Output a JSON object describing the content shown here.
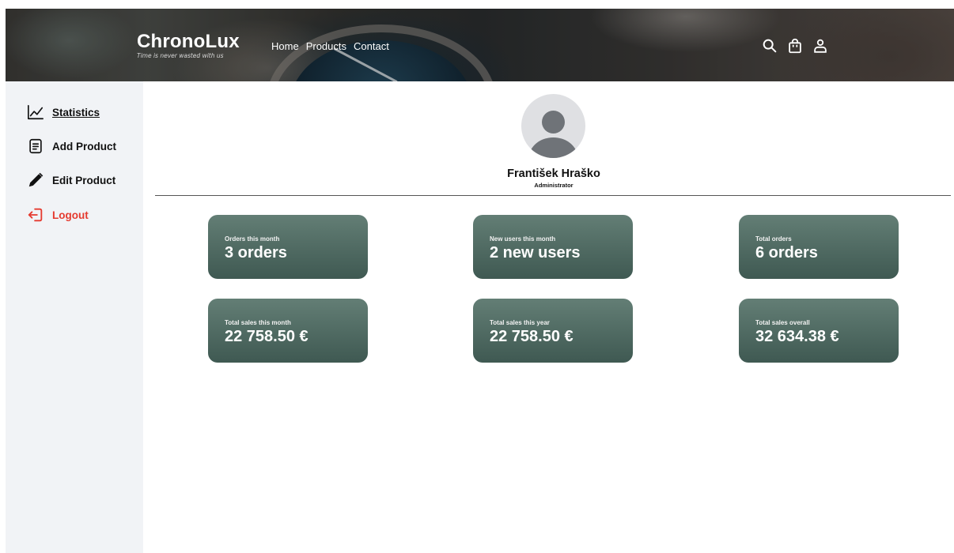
{
  "header": {
    "brand": "ChronoLux",
    "tagline": "Time is never wasted with us",
    "nav": [
      "Home",
      "Products",
      "Contact"
    ],
    "icons": [
      "search-icon",
      "shopping-bag-icon",
      "user-icon"
    ]
  },
  "sidebar": {
    "items": [
      {
        "label": "Statistics",
        "icon": "chart-line-icon",
        "active": true
      },
      {
        "label": "Add Product",
        "icon": "document-icon"
      },
      {
        "label": "Edit Product",
        "icon": "pencil-icon"
      },
      {
        "label": "Logout",
        "icon": "logout-icon",
        "color": "#e53a2f"
      }
    ]
  },
  "profile": {
    "name": "František Hraško",
    "role": "Administrator"
  },
  "stats": [
    {
      "label": "Orders this month",
      "value": "3 orders"
    },
    {
      "label": "New users this month",
      "value": "2 new users"
    },
    {
      "label": "Total orders",
      "value": "6 orders"
    },
    {
      "label": "Total sales this month",
      "value": "22 758.50 €"
    },
    {
      "label": "Total sales this year",
      "value": "22 758.50 €"
    },
    {
      "label": "Total sales overall",
      "value": "32 634.38 €"
    }
  ],
  "colors": {
    "sidebar_bg": "#f1f3f6",
    "card_top": "#637e75",
    "card_bottom": "#3f5952",
    "logout": "#e53a2f"
  }
}
